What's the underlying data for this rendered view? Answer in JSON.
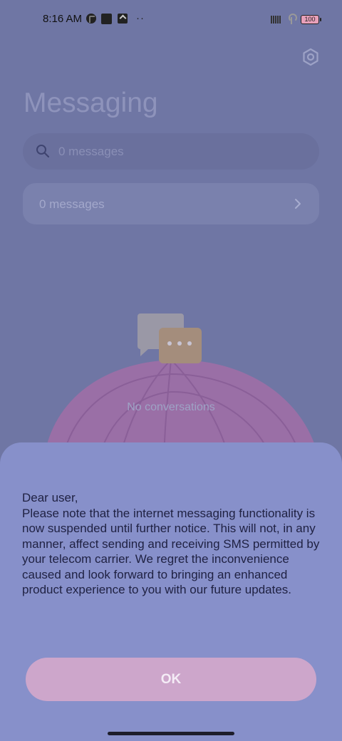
{
  "status_bar": {
    "time": "8:16 AM",
    "more": "··",
    "battery": "100",
    "icons": [
      "app-notification-icon",
      "app-notification-icon",
      "upload-notification-icon",
      "signal-icon",
      "wifi-icon",
      "battery-icon"
    ]
  },
  "page": {
    "title": "Messaging",
    "search_placeholder": "0 messages",
    "messages_row_label": "0 messages",
    "empty_state": "No conversations"
  },
  "dialog": {
    "message": "Dear user,\nPlease note that the internet messaging functionality is now suspended until further notice. This will not, in any manner, affect sending and receiving SMS permitted by your telecom carrier. We regret the inconvenience caused and look forward to bringing an enhanced product experience to you with our future updates.",
    "ok_label": "OK"
  },
  "colors": {
    "scrim": "#6f76a4",
    "sheet": "#8790ca",
    "ok_button": "#cda6cb"
  }
}
